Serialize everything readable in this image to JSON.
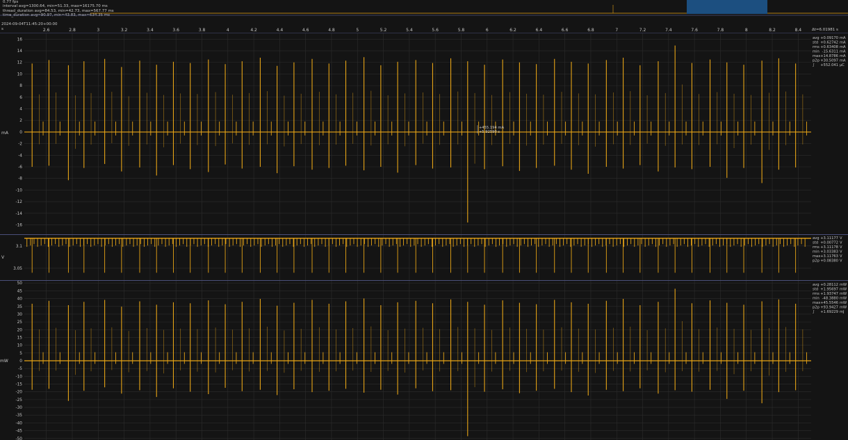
{
  "header": {
    "fps": "0.77 fps",
    "interval": "interval avg=1300.64, min=51.33, max=16175.70 ms",
    "thread": "thread_duration avg=84.53, min=42.73, max=567.77 ms",
    "time": "time_duration avg=90.97, min=43.83, max=634.35 ms",
    "timestamp": "2024-09-04T11:45:20+00:00",
    "x_unit": "s",
    "delta": "Δt=6.01981 s"
  },
  "cursor": {
    "value": "+455.194 mA",
    "time": "+5.92590 s",
    "x": 5.9259,
    "y": 0.455
  },
  "colors": {
    "background": "#141414",
    "trace": "#e8a516",
    "grid": "#2c2c2c",
    "separator": "#4a4f7a",
    "overview_highlight": "#1c4f80",
    "text": "#c8c8c8"
  },
  "chart_data": [
    {
      "type": "line",
      "name": "current",
      "ylabel": "mA",
      "ylim": [
        -17.5,
        17
      ],
      "yticks": [
        16,
        14,
        12,
        10,
        8,
        6,
        4,
        2,
        0,
        -2,
        -4,
        -6,
        -8,
        -10,
        -12,
        -14,
        -16
      ],
      "xlim": [
        2.43,
        8.5
      ],
      "xticks": [
        2.6,
        2.8,
        3,
        3.2,
        3.4,
        3.6,
        3.8,
        4,
        4.2,
        4.4,
        4.6,
        4.8,
        5,
        5.2,
        5.4,
        5.6,
        5.8,
        6,
        6.2,
        6.4,
        6.6,
        6.8,
        7,
        7.2,
        7.4,
        7.6,
        7.8,
        8,
        8.2,
        8.4
      ],
      "baseline": 0,
      "spikes": [
        {
          "x": 2.49,
          "max": 11.8,
          "min": -6.0
        },
        {
          "x": 2.62,
          "max": 12.4,
          "min": -5.8
        },
        {
          "x": 2.77,
          "max": 11.5,
          "min": -8.3
        },
        {
          "x": 2.89,
          "max": 12.2,
          "min": -6.2
        },
        {
          "x": 3.05,
          "max": 12.6,
          "min": -5.5
        },
        {
          "x": 3.18,
          "max": 11.2,
          "min": -6.8
        },
        {
          "x": 3.32,
          "max": 12.3,
          "min": -6.1
        },
        {
          "x": 3.45,
          "max": 11.6,
          "min": -7.5
        },
        {
          "x": 3.58,
          "max": 12.1,
          "min": -5.7
        },
        {
          "x": 3.71,
          "max": 11.9,
          "min": -6.4
        },
        {
          "x": 3.85,
          "max": 12.5,
          "min": -6.9
        },
        {
          "x": 3.98,
          "max": 11.7,
          "min": -5.6
        },
        {
          "x": 4.11,
          "max": 12.2,
          "min": -6.3
        },
        {
          "x": 4.25,
          "max": 12.8,
          "min": -6.0
        },
        {
          "x": 4.38,
          "max": 11.4,
          "min": -7.1
        },
        {
          "x": 4.51,
          "max": 12.0,
          "min": -5.9
        },
        {
          "x": 4.65,
          "max": 12.6,
          "min": -6.5
        },
        {
          "x": 4.78,
          "max": 11.8,
          "min": -6.2
        },
        {
          "x": 4.91,
          "max": 12.3,
          "min": -5.8
        },
        {
          "x": 5.05,
          "max": 12.9,
          "min": -6.6
        },
        {
          "x": 5.18,
          "max": 11.5,
          "min": -6.0
        },
        {
          "x": 5.31,
          "max": 12.1,
          "min": -7.0
        },
        {
          "x": 5.45,
          "max": 12.4,
          "min": -5.7
        },
        {
          "x": 5.58,
          "max": 11.9,
          "min": -6.3
        },
        {
          "x": 5.72,
          "max": 12.7,
          "min": -6.1
        },
        {
          "x": 5.85,
          "max": 12.2,
          "min": -15.6
        },
        {
          "x": 5.98,
          "max": 11.6,
          "min": -6.4
        },
        {
          "x": 6.12,
          "max": 12.5,
          "min": -5.9
        },
        {
          "x": 6.25,
          "max": 12.0,
          "min": -6.7
        },
        {
          "x": 6.38,
          "max": 11.7,
          "min": -6.2
        },
        {
          "x": 6.52,
          "max": 12.6,
          "min": -5.8
        },
        {
          "x": 6.65,
          "max": 12.1,
          "min": -6.5
        },
        {
          "x": 6.78,
          "max": 11.8,
          "min": -7.2
        },
        {
          "x": 6.92,
          "max": 12.4,
          "min": -6.0
        },
        {
          "x": 7.05,
          "max": 12.8,
          "min": -6.3
        },
        {
          "x": 7.18,
          "max": 11.5,
          "min": -5.7
        },
        {
          "x": 7.32,
          "max": 12.2,
          "min": -6.8
        },
        {
          "x": 7.45,
          "max": 14.9,
          "min": -6.1
        },
        {
          "x": 7.58,
          "max": 11.9,
          "min": -6.4
        },
        {
          "x": 7.72,
          "max": 12.5,
          "min": -6.0
        },
        {
          "x": 7.85,
          "max": 12.0,
          "min": -7.9
        },
        {
          "x": 7.98,
          "max": 11.6,
          "min": -6.2
        },
        {
          "x": 8.12,
          "max": 12.3,
          "min": -8.8
        },
        {
          "x": 8.25,
          "max": 12.7,
          "min": -6.5
        },
        {
          "x": 8.38,
          "max": 11.8,
          "min": -6.1
        }
      ],
      "stats": [
        {
          "label": "avg",
          "value": "+0.09170",
          "unit": "mA"
        },
        {
          "label": "std",
          "value": "+0.62742",
          "unit": "mA"
        },
        {
          "label": "rms",
          "value": "+0.63408",
          "unit": "mA"
        },
        {
          "label": "min",
          "value": "-15.6311",
          "unit": "mA"
        },
        {
          "label": "max",
          "value": "+14.8786",
          "unit": "mA"
        },
        {
          "label": "p2p",
          "value": "+30.5097",
          "unit": "mA"
        },
        {
          "label": "∫",
          "value": "+552.041",
          "unit": "µC"
        }
      ]
    },
    {
      "type": "line",
      "name": "voltage",
      "ylabel": "V",
      "ylim": [
        3.025,
        3.123
      ],
      "yticks": [
        3.1,
        3.05
      ],
      "baseline": 3.117,
      "dip_min": 3.098,
      "deep_dip": 3.04,
      "stats": [
        {
          "label": "avg",
          "value": "+3.11177",
          "unit": "V"
        },
        {
          "label": "std",
          "value": "+0.00772",
          "unit": "V"
        },
        {
          "label": "rms",
          "value": "+3.11178",
          "unit": "V"
        },
        {
          "label": "min",
          "value": "+3.03383",
          "unit": "V"
        },
        {
          "label": "max",
          "value": "+3.11763",
          "unit": "V"
        },
        {
          "label": "p2p",
          "value": "+0.08380",
          "unit": "V"
        }
      ]
    },
    {
      "type": "line",
      "name": "power",
      "ylabel": "mW",
      "ylim": [
        -51,
        51
      ],
      "yticks": [
        50,
        45,
        40,
        35,
        30,
        25,
        20,
        15,
        10,
        5,
        0,
        -5,
        -10,
        -15,
        -20,
        -25,
        -30,
        -35,
        -40,
        -45,
        -50
      ],
      "baseline": 0,
      "stats": [
        {
          "label": "avg",
          "value": "+0.28112",
          "unit": "mW"
        },
        {
          "label": "std",
          "value": "+1.95697",
          "unit": "mW"
        },
        {
          "label": "rms",
          "value": "+1.93747",
          "unit": "mW"
        },
        {
          "label": "min",
          "value": "-48.3880",
          "unit": "mW"
        },
        {
          "label": "max",
          "value": "+45.5546",
          "unit": "mW"
        },
        {
          "label": "p2p",
          "value": "+93.9427",
          "unit": "mW"
        },
        {
          "label": "∫",
          "value": "+1.69229",
          "unit": "mJ"
        }
      ]
    }
  ]
}
